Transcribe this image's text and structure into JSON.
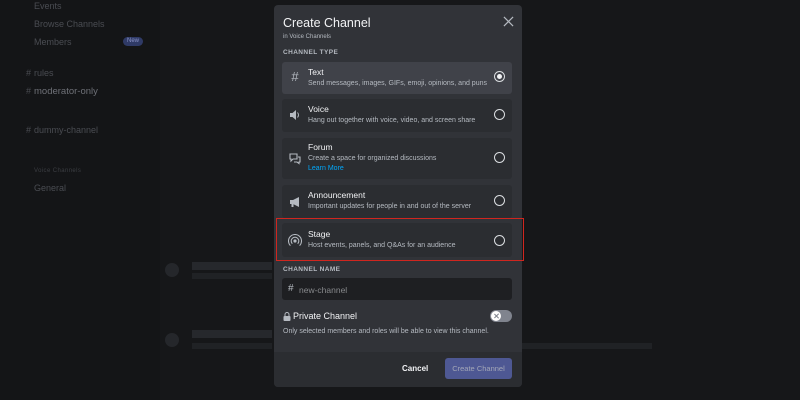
{
  "background": {
    "sidebar_items": [
      "Events",
      "Browse Channels",
      "Members",
      "rules",
      "moderator-only",
      "dummy-channel",
      "Voice Channels",
      "General"
    ],
    "badge": "New"
  },
  "modal": {
    "title": "Create Channel",
    "subtitle": "in Voice Channels",
    "channel_type_label": "CHANNEL TYPE",
    "options": [
      {
        "name": "Text",
        "description": "Send messages, images, GIFs, emoji, opinions, and puns",
        "icon": "hashtag-icon",
        "selected": true
      },
      {
        "name": "Voice",
        "description": "Hang out together with voice, video, and screen share",
        "icon": "speaker-icon",
        "selected": false
      },
      {
        "name": "Forum",
        "description": "Create a space for organized discussions",
        "link": "Learn More",
        "icon": "forum-icon",
        "selected": false
      },
      {
        "name": "Announcement",
        "description": "Important updates for people in and out of the server",
        "icon": "megaphone-icon",
        "selected": false
      },
      {
        "name": "Stage",
        "description": "Host events, panels, and Q&As for an audience",
        "icon": "stage-icon",
        "selected": false
      }
    ],
    "channel_name_label": "CHANNEL NAME",
    "channel_name_placeholder": "new-channel",
    "channel_name_value": "",
    "private_title": "Private Channel",
    "private_desc": "Only selected members and roles will be able to view this channel.",
    "private_enabled": false,
    "cancel_label": "Cancel",
    "create_label": "Create Channel"
  },
  "colors": {
    "modal_bg": "#313338",
    "selected_option": "#404249",
    "link": "#00a8fc",
    "highlight": "#d0261f",
    "create_button": "#4e5893"
  }
}
